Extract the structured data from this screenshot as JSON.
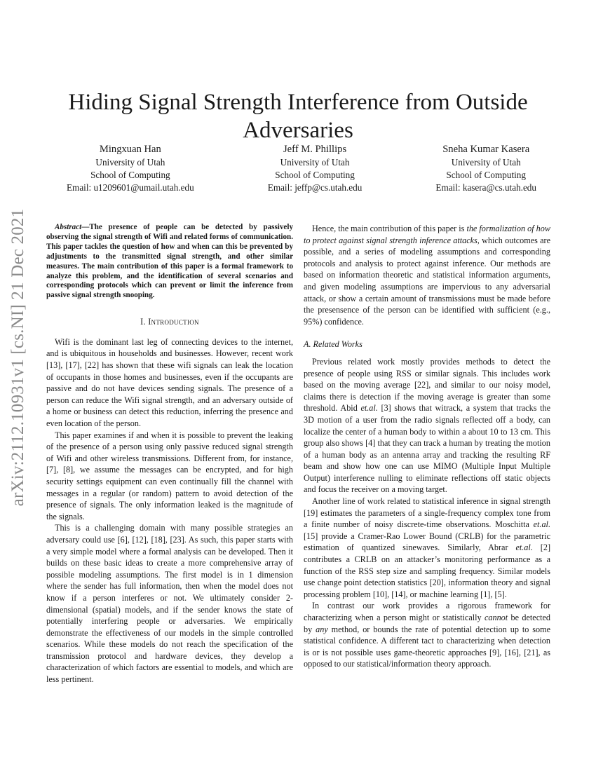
{
  "sidebar_stamp": "arXiv:2112.10931v1  [cs.NI]  21 Dec 2021",
  "title": "Hiding Signal Strength Interference from Outside Adversaries",
  "authors": [
    {
      "name": "Mingxuan Han",
      "affiliation": "University of Utah",
      "dept": "School of Computing",
      "email": "Email: u1209601@umail.utah.edu"
    },
    {
      "name": "Jeff M. Phillips",
      "affiliation": "University of Utah",
      "dept": "School of Computing",
      "email": "Email: jeffp@cs.utah.edu"
    },
    {
      "name": "Sneha Kumar Kasera",
      "affiliation": "University of Utah",
      "dept": "School of Computing",
      "email": "Email: kasera@cs.utah.edu"
    }
  ],
  "abstract": {
    "lead": "Abstract",
    "text": "—The presence of people can be detected by passively observing the signal strength of Wifi and related forms of communication. This paper tackles the question of how and when can this be prevented by adjustments to the transmitted signal strength, and other similar measures. The main contribution of this paper is a formal framework to analyze this problem, and the identification of several scenarios and corresponding protocols which can prevent or limit the inference from passive signal strength snooping."
  },
  "section1": {
    "number": "I.",
    "title": "Introduction",
    "paragraphs": [
      "Wifi is the dominant last leg of connecting devices to the internet, and is ubiquitous in households and businesses. However, recent work [13], [17], [22] has shown that these wifi signals can leak the location of occupants in those homes and businesses, even if the occupants are passive and do not have devices sending signals. The presence of a person can reduce the Wifi signal strength, and an adversary outside of a home or business can detect this reduction, inferring the presence and even location of the person.",
      "This paper examines if and when it is possible to prevent the leaking of the presence of a person using only passive reduced signal strength of Wifi and other wireless transmissions. Different from, for instance, [7], [8], we assume the messages can be encrypted, and for high security settings equipment can even continually fill the channel with messages in a regular (or random) pattern to avoid detection of the presence of signals. The only information leaked is the magnitude of the signals.",
      "This is a challenging domain with many possible strategies an adversary could use [6], [12], [18], [23]. As such, this paper starts with a very simple model where a formal analysis can be developed. Then it builds on these basic ideas to create a more comprehensive array of possible modeling assumptions. The first model is in 1 dimension where the sender has full information, then when the model does not know if a person interferes or not. We ultimately consider 2-dimensional (spatial) models, and if the sender knows the state of potentially interfering people or adversaries. We empirically demonstrate the effectiveness of our models in the simple controlled scenarios. While these models do not reach the specification of the transmission protocol and hardware devices, they develop a characterization of which factors are essential to models, and which are less pertinent."
    ]
  },
  "right_column": {
    "contribution": {
      "pre": "Hence, the main contribution of this paper is ",
      "emph": "the formalization of how to protect against signal strength inference attacks",
      "post": ", which outcomes are possible, and a series of modeling assumptions and corresponding protocols and analysis to protect against inference. Our methods are based on information theoretic and statistical information arguments, and given modeling assumptions are impervious to any adversarial attack, or show a certain amount of transmissions must be made before the presensence of the person can be identified with sufficient (e.g., 95%) confidence."
    },
    "subsection": "A.  Related Works",
    "p1": {
      "a": "Previous related work mostly provides methods to detect the presence of people using RSS or similar signals. This includes work based on the moving average [22], and similar to our noisy model, claims there is detection if the moving average is greater than some threshold. Abid ",
      "etal1": "et.al.",
      "b": " [3] shows that witrack, a system that tracks the 3D motion of a user from the radio signals reflected off a body, can localize the center of a human body to within a about 10 to 13 cm. This group also shows [4] that they can track a human by treating the motion of a human body as an antenna array and tracking the resulting RF beam and show how one can use MIMO (Multiple Input Multiple Output) interference nulling to eliminate reflections off static objects and focus the receiver on a moving target."
    },
    "p2": {
      "a": "Another line of work related to statistical inference in signal strength [19] estimates the parameters of a single-frequency complex tone from a finite number of noisy discrete-time observations. Moschitta ",
      "etal1": "et.al.",
      "b": " [15] provide a Cramer-Rao Lower Bound (CRLB) for the parametric estimation of quantized sinewaves. Similarly, Abrar ",
      "etal2": "et.al.",
      "c": " [2] contributes a CRLB on an attacker’s monitoring performance as a function of the RSS step size and sampling frequency. Similar models use change point detection statistics [20], information theory and signal processing problem [10], [14], or machine learning [1], [5]."
    },
    "p3": {
      "a": "In contrast our work provides a rigorous framework for characterizing when a person might or statistically ",
      "emph1": "cannot",
      "b": " be detected by ",
      "emph2": "any",
      "c": " method, or bounds the rate of potential detection up to some statistical confidence. A different tact to characterizing when detection is or is not possible uses game-theoretic approaches [9], [16], [21], as opposed to our statistical/information theory approach."
    }
  }
}
